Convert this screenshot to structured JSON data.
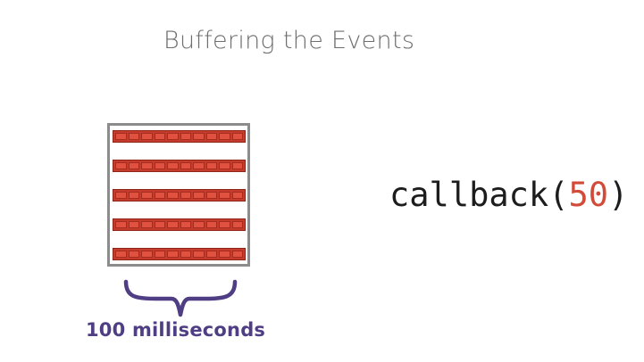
{
  "slide": {
    "title": "Buffering the Events"
  },
  "buffer": {
    "rows": 5,
    "cells_per_row": 10,
    "fill_color": "#c53b2c",
    "cell_color": "#e0523f",
    "frame_color": "#8c8c8c"
  },
  "duration": {
    "label": "100 milliseconds",
    "color": "#4f3e84"
  },
  "callback": {
    "name": "callback",
    "open_paren": "(",
    "argument": "50",
    "close_paren": ")",
    "argument_color": "#d24a38"
  }
}
